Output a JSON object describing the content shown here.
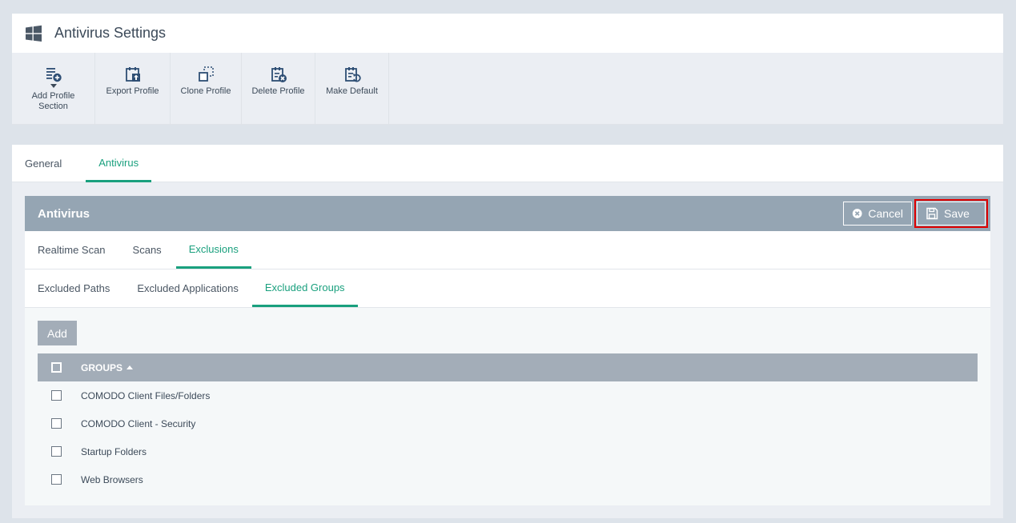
{
  "header": {
    "title": "Antivirus Settings",
    "icon": "windows-logo-icon"
  },
  "toolbar": {
    "items": [
      {
        "label": "Add Profile Section",
        "icon": "add-list-icon"
      },
      {
        "label": "Export Profile",
        "icon": "export-icon"
      },
      {
        "label": "Clone Profile",
        "icon": "clone-icon"
      },
      {
        "label": "Delete Profile",
        "icon": "delete-list-icon"
      },
      {
        "label": "Make Default",
        "icon": "default-list-icon"
      }
    ]
  },
  "top_tabs": [
    {
      "label": "General",
      "active": false
    },
    {
      "label": "Antivirus",
      "active": true
    }
  ],
  "panel": {
    "title": "Antivirus",
    "cancel_label": "Cancel",
    "save_label": "Save",
    "tabs": [
      {
        "label": "Realtime Scan",
        "active": false
      },
      {
        "label": "Scans",
        "active": false
      },
      {
        "label": "Exclusions",
        "active": true
      }
    ],
    "subtabs": [
      {
        "label": "Excluded Paths",
        "active": false
      },
      {
        "label": "Excluded Applications",
        "active": false
      },
      {
        "label": "Excluded Groups",
        "active": true
      }
    ]
  },
  "grid": {
    "add_label": "Add",
    "column": "GROUPS",
    "rows": [
      "COMODO Client Files/Folders",
      "COMODO Client - Security",
      "Startup Folders",
      "Web Browsers"
    ]
  },
  "colors": {
    "accent": "#1aa07e",
    "panel_header": "#95a5b3",
    "grid_header": "#a3adb8",
    "highlight": "#e00000"
  }
}
